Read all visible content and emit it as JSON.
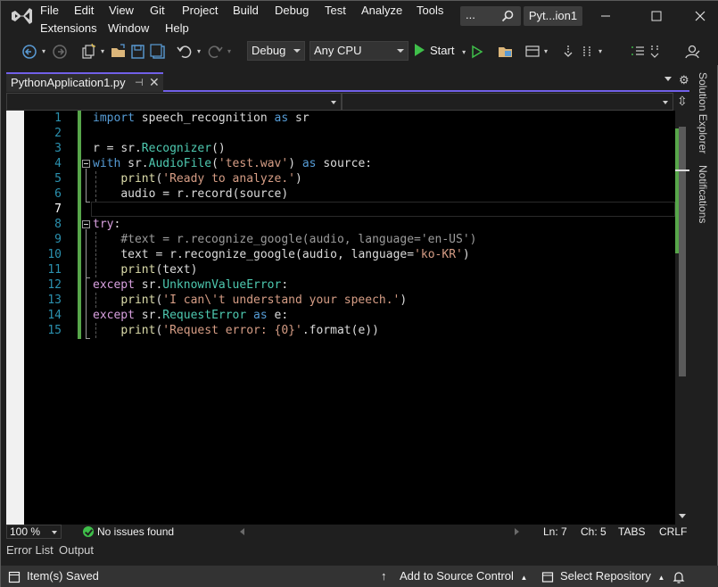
{
  "title_bar": {
    "menu": [
      "File",
      "Edit",
      "View",
      "Git",
      "Project",
      "Build",
      "Debug",
      "Test",
      "Analyze",
      "Tools",
      "Extensions",
      "Window",
      "Help"
    ],
    "search_text": "...",
    "solution_name": "Pyt...ion1"
  },
  "toolbar": {
    "configuration": "Debug",
    "platform": "Any CPU",
    "start_label": "Start"
  },
  "tab": {
    "filename": "PythonApplication1.py"
  },
  "side_panels": [
    "Solution Explorer",
    "Notifications"
  ],
  "editor": {
    "language": "python",
    "line_numbers": [
      "1",
      "2",
      "3",
      "4",
      "5",
      "6",
      "7",
      "8",
      "9",
      "10",
      "11",
      "12",
      "13",
      "14",
      "15"
    ],
    "lines": [
      "import speech_recognition as sr",
      "",
      "r = sr.Recognizer()",
      "with sr.AudioFile('test.wav') as source:",
      "    print('Ready to analyze.')",
      "    audio = r.record(source)",
      "",
      "try:",
      "    #text = r.recognize_google(audio, language='en-US')",
      "    text = r.recognize_google(audio, language='ko-KR')",
      "    print(text)",
      "except sr.UnknownValueError:",
      "    print('I can\\'t understand your speech.')",
      "except sr.RequestError as e:",
      "    print('Request error: {0}'.format(e))"
    ],
    "current_line": "7"
  },
  "editor_status": {
    "zoom": "100 %",
    "issues": "No issues found",
    "line": "Ln: 7",
    "column": "Ch: 5",
    "tabs": "TABS",
    "line_ending": "CRLF"
  },
  "tool_tabs": [
    "Error List",
    "Output"
  ],
  "status_bar": {
    "message": "Item(s) Saved",
    "source_control": "Add to Source Control",
    "repository": "Select Repository"
  },
  "colors": {
    "keyword": "#569cd6",
    "control_keyword": "#d8a0df",
    "class": "#4ec9b0",
    "string": "#d69d85",
    "function": "#dcdcaa",
    "comment": "#9b9b9b",
    "line_number": "#2b91af",
    "accent": "#7160e8",
    "run_green": "#3fbf4a"
  }
}
